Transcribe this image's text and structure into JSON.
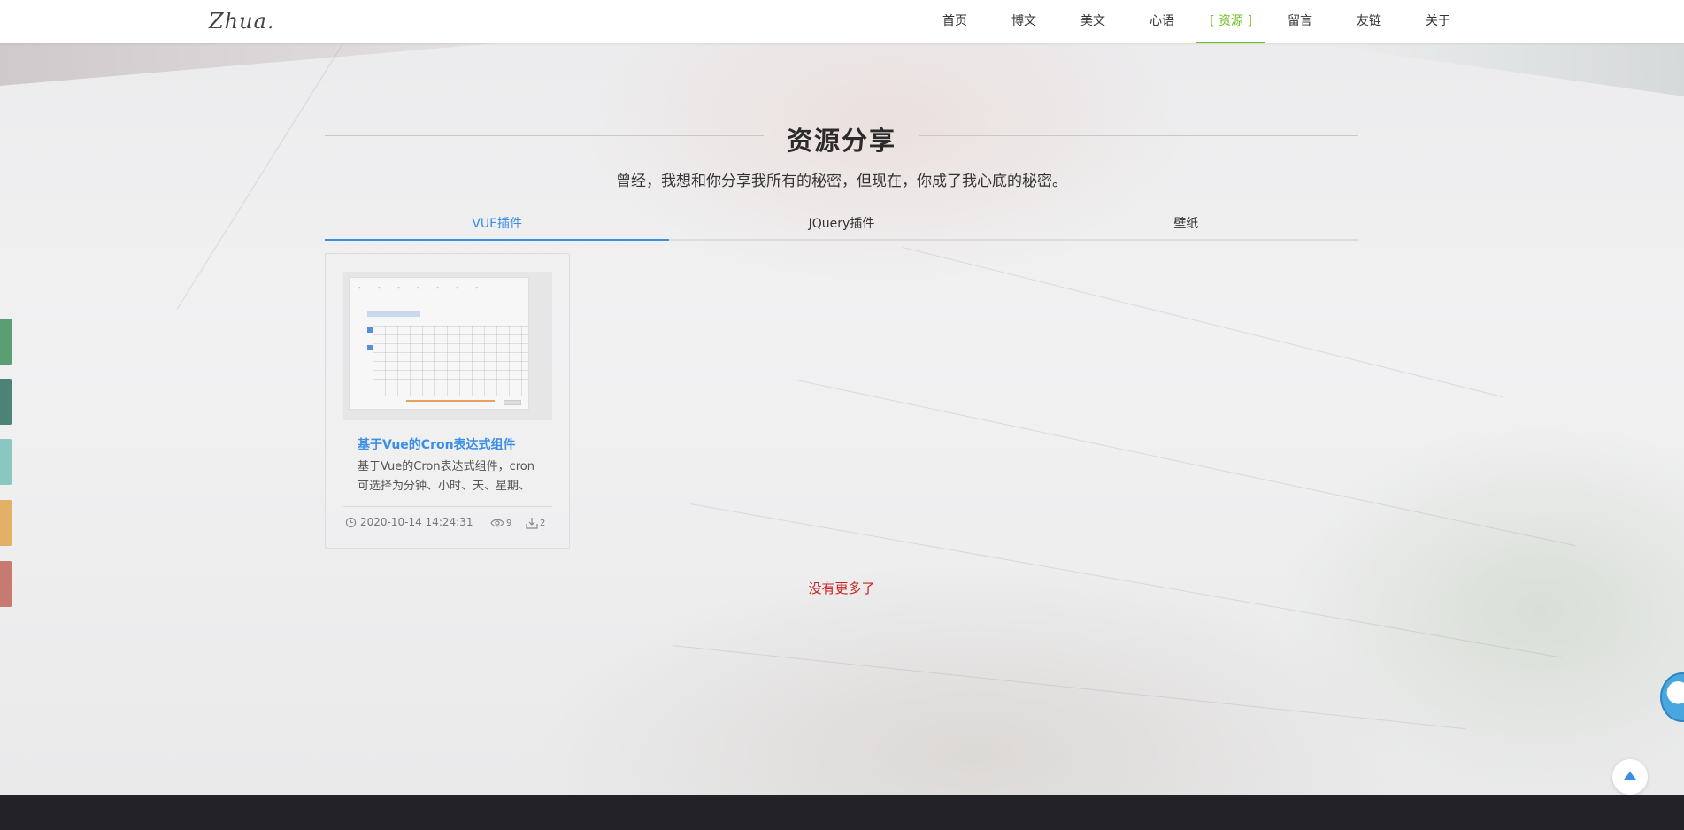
{
  "header": {
    "logo": "Zhua.",
    "nav": [
      "首页",
      "博文",
      "美文",
      "心语",
      "[ 资源 ]",
      "留言",
      "友链",
      "关于"
    ],
    "active_nav_index": 4
  },
  "side_tabs": [
    {
      "color": "#5a9e73"
    },
    {
      "color": "#4d8277"
    },
    {
      "color": "#89c7bf"
    },
    {
      "color": "#e4b066"
    },
    {
      "color": "#c97a70"
    }
  ],
  "page": {
    "title": "资源分享",
    "subtitle": "曾经，我想和你分享我所有的秘密，但现在，你成了我心底的秘密。",
    "tabs": [
      "VUE插件",
      "JQuery插件",
      "壁纸"
    ],
    "active_tab_index": 0
  },
  "cards": [
    {
      "title": "基于Vue的Cron表达式组件",
      "description": "基于Vue的Cron表达式组件，cron可选择为分钟、小时、天、星期、",
      "date": "2020-10-14 14:24:31",
      "views": "9",
      "downloads": "2",
      "thumbnail": "cron-calendar-screenshot"
    }
  ],
  "status": {
    "no_more": "没有更多了"
  },
  "colors": {
    "accent_green": "#6bbf1a",
    "accent_blue": "#3b8ee6",
    "no_more_red": "#cc1f1f",
    "footer": "#222228"
  }
}
